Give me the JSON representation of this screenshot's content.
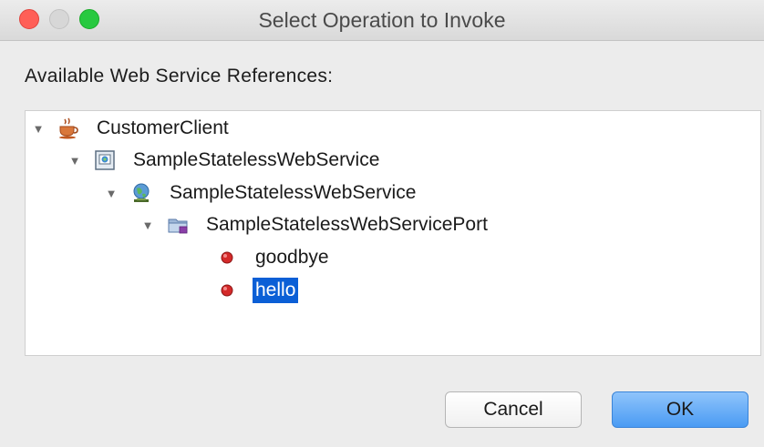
{
  "window": {
    "title": "Select Operation to Invoke"
  },
  "section_label": "Available Web Service References:",
  "tree": {
    "nodes": [
      {
        "label": "CustomerClient",
        "icon": "java-cup-icon",
        "expanded": true
      },
      {
        "label": "SampleStatelessWebService",
        "icon": "web-service-client-icon",
        "expanded": true
      },
      {
        "label": "SampleStatelessWebService",
        "icon": "globe-service-icon",
        "expanded": true
      },
      {
        "label": "SampleStatelessWebServicePort",
        "icon": "folder-port-icon",
        "expanded": true
      },
      {
        "label": "goodbye",
        "icon": "operation-red-dot-icon"
      },
      {
        "label": "hello",
        "icon": "operation-red-dot-icon",
        "selected": true
      }
    ]
  },
  "buttons": {
    "cancel": "Cancel",
    "ok": "OK"
  },
  "colors": {
    "selection": "#0b5fd6",
    "ok_button": "#4a9bf3",
    "close_light": "#ff5f57",
    "zoom_light": "#28c940"
  }
}
